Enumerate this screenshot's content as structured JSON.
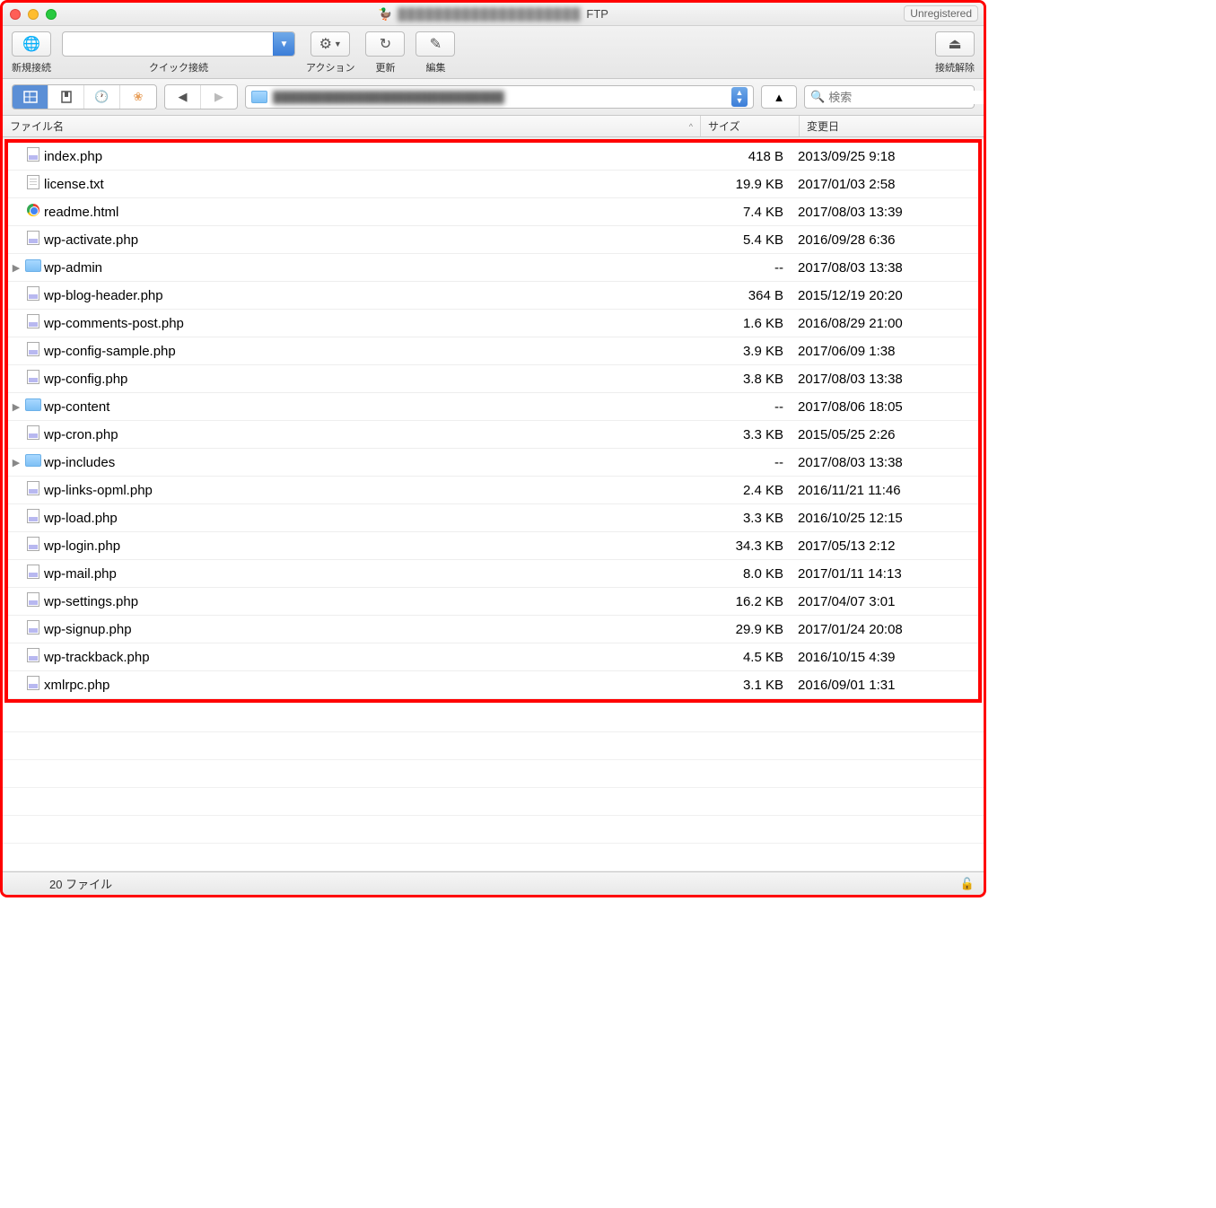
{
  "titlebar": {
    "protocol": "FTP",
    "unregistered": "Unregistered"
  },
  "toolbar": {
    "new_connection": "新規接続",
    "quick_connect": "クイック接続",
    "action": "アクション",
    "refresh": "更新",
    "edit": "編集",
    "disconnect": "接続解除"
  },
  "search": {
    "placeholder": "検索"
  },
  "columns": {
    "name": "ファイル名",
    "size": "サイズ",
    "modified": "変更日"
  },
  "files": [
    {
      "type": "php",
      "folder": false,
      "name": "index.php",
      "size": "418 B",
      "date": "2013/09/25 9:18"
    },
    {
      "type": "txt",
      "folder": false,
      "name": "license.txt",
      "size": "19.9 KB",
      "date": "2017/01/03 2:58"
    },
    {
      "type": "html",
      "folder": false,
      "name": "readme.html",
      "size": "7.4 KB",
      "date": "2017/08/03 13:39"
    },
    {
      "type": "php",
      "folder": false,
      "name": "wp-activate.php",
      "size": "5.4 KB",
      "date": "2016/09/28 6:36"
    },
    {
      "type": "folder",
      "folder": true,
      "name": "wp-admin",
      "size": "--",
      "date": "2017/08/03 13:38"
    },
    {
      "type": "php",
      "folder": false,
      "name": "wp-blog-header.php",
      "size": "364 B",
      "date": "2015/12/19 20:20"
    },
    {
      "type": "php",
      "folder": false,
      "name": "wp-comments-post.php",
      "size": "1.6 KB",
      "date": "2016/08/29 21:00"
    },
    {
      "type": "php",
      "folder": false,
      "name": "wp-config-sample.php",
      "size": "3.9 KB",
      "date": "2017/06/09 1:38"
    },
    {
      "type": "php",
      "folder": false,
      "name": "wp-config.php",
      "size": "3.8 KB",
      "date": "2017/08/03 13:38"
    },
    {
      "type": "folder",
      "folder": true,
      "name": "wp-content",
      "size": "--",
      "date": "2017/08/06 18:05"
    },
    {
      "type": "php",
      "folder": false,
      "name": "wp-cron.php",
      "size": "3.3 KB",
      "date": "2015/05/25 2:26"
    },
    {
      "type": "folder",
      "folder": true,
      "name": "wp-includes",
      "size": "--",
      "date": "2017/08/03 13:38"
    },
    {
      "type": "php",
      "folder": false,
      "name": "wp-links-opml.php",
      "size": "2.4 KB",
      "date": "2016/11/21 11:46"
    },
    {
      "type": "php",
      "folder": false,
      "name": "wp-load.php",
      "size": "3.3 KB",
      "date": "2016/10/25 12:15"
    },
    {
      "type": "php",
      "folder": false,
      "name": "wp-login.php",
      "size": "34.3 KB",
      "date": "2017/05/13 2:12"
    },
    {
      "type": "php",
      "folder": false,
      "name": "wp-mail.php",
      "size": "8.0 KB",
      "date": "2017/01/11 14:13"
    },
    {
      "type": "php",
      "folder": false,
      "name": "wp-settings.php",
      "size": "16.2 KB",
      "date": "2017/04/07 3:01"
    },
    {
      "type": "php",
      "folder": false,
      "name": "wp-signup.php",
      "size": "29.9 KB",
      "date": "2017/01/24 20:08"
    },
    {
      "type": "php",
      "folder": false,
      "name": "wp-trackback.php",
      "size": "4.5 KB",
      "date": "2016/10/15 4:39"
    },
    {
      "type": "php",
      "folder": false,
      "name": "xmlrpc.php",
      "size": "3.1 KB",
      "date": "2016/09/01 1:31"
    }
  ],
  "status": {
    "count": "20 ファイル"
  }
}
